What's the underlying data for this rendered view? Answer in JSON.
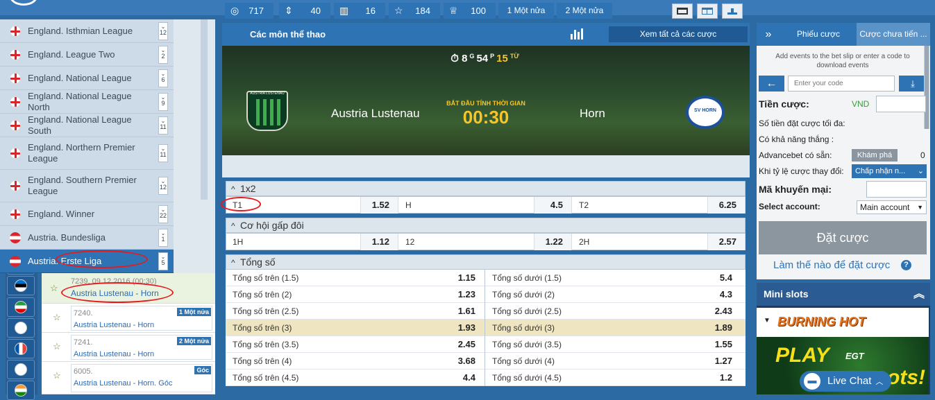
{
  "sidebar_leagues": [
    {
      "name": "England. Isthmian League",
      "count": "12"
    },
    {
      "name": "England. League Two",
      "count": "2"
    },
    {
      "name": "England. National League",
      "count": "6"
    },
    {
      "name": "England. National League North",
      "count": "9"
    },
    {
      "name": "England. National League South",
      "count": "11"
    },
    {
      "name": "England. Northern Premier League",
      "count": "11"
    },
    {
      "name": "England. Southern Premier League",
      "count": "12"
    },
    {
      "name": "England. Winner",
      "count": "22"
    },
    {
      "name": "Austria. Bundesliga",
      "count": "1"
    },
    {
      "name": "Austria. Erste Liga",
      "count": "5"
    }
  ],
  "sidebar_matches": [
    {
      "id": "7239. 09.12.2016 (00:30)",
      "name": "Austria Lustenau - Horn",
      "badge": ""
    },
    {
      "id": "7240.",
      "name": "Austria Lustenau - Horn",
      "badge": "1 Một nửa"
    },
    {
      "id": "7241.",
      "name": "Austria Lustenau - Horn",
      "badge": "2 Một nửa"
    },
    {
      "id": "6005.",
      "name": "Austria Lustenau - Horn. Góc",
      "badge": "Góc"
    }
  ],
  "header": {
    "title": "Các môn thể thao",
    "view_all": "Xem tất cả các cược"
  },
  "countdown": {
    "days": "8",
    "days_unit": "G",
    "hours": "54",
    "hours_unit": "P",
    "minutes": "15",
    "minutes_unit": "TỪ"
  },
  "event": {
    "home": "Austria Lustenau",
    "away": "Horn",
    "start_label": "BẮT ĐẦU TÍNH THỜI GIAN",
    "time": "00:30",
    "home_crest_text": "AUSTRIA LUSTENAU",
    "away_crest_text": "SV HORN"
  },
  "stats": [
    {
      "icon": "target-icon",
      "value": "717"
    },
    {
      "icon": "updown-icon",
      "value": "40"
    },
    {
      "icon": "bars-icon",
      "value": "16"
    },
    {
      "icon": "star-icon",
      "value": "184"
    },
    {
      "icon": "trophy-icon",
      "value": "100"
    }
  ],
  "half_tabs": [
    "1 Một nửa",
    "2 Một nửa"
  ],
  "markets": {
    "m1x2": {
      "title": "1x2",
      "cells": [
        [
          "T1",
          "1.52"
        ],
        [
          "H",
          "4.5"
        ],
        [
          "T2",
          "6.25"
        ]
      ]
    },
    "double": {
      "title": "Cơ hội gấp đôi",
      "cells": [
        [
          "1H",
          "1.12"
        ],
        [
          "12",
          "1.22"
        ],
        [
          "2H",
          "2.57"
        ]
      ]
    },
    "totals": {
      "title": "Tổng số",
      "rows": [
        {
          "over": "Tổng số trên (1.5)",
          "over_odd": "1.15",
          "under": "Tổng số dưới (1.5)",
          "under_odd": "5.4",
          "highlight": false
        },
        {
          "over": "Tổng số trên (2)",
          "over_odd": "1.23",
          "under": "Tổng số dưới (2)",
          "under_odd": "4.3",
          "highlight": false
        },
        {
          "over": "Tổng số trên (2.5)",
          "over_odd": "1.61",
          "under": "Tổng số dưới (2.5)",
          "under_odd": "2.43",
          "highlight": false
        },
        {
          "over": "Tổng số trên (3)",
          "over_odd": "1.93",
          "under": "Tổng số dưới (3)",
          "under_odd": "1.89",
          "highlight": true
        },
        {
          "over": "Tổng số trên (3.5)",
          "over_odd": "2.45",
          "under": "Tổng số dưới (3.5)",
          "under_odd": "1.55",
          "highlight": false
        },
        {
          "over": "Tổng số trên (4)",
          "over_odd": "3.68",
          "under": "Tổng số dưới (4)",
          "under_odd": "1.27",
          "highlight": false
        },
        {
          "over": "Tổng số trên (4.5)",
          "over_odd": "4.4",
          "under": "Tổng số dưới (4.5)",
          "under_odd": "1.2",
          "highlight": false
        }
      ]
    }
  },
  "betslip": {
    "tab1": "Phiếu cược",
    "tab2": "Cược chưa tiến ...",
    "hint": "Add events to the bet slip or enter a code to download events",
    "code_placeholder": "Enter your code",
    "stake_label": "Tiền cược:",
    "currency": "VND",
    "max_label": "Số tiền đặt cược tối đa:",
    "win_label": "Có khả năng thắng :",
    "advancebet_label": "Advancebet có sẵn:",
    "explore": "Khám phá",
    "advancebet_value": "0",
    "odds_change_label": "Khi tỷ lệ cược thay đổi:",
    "odds_change_value": "Chấp nhận n...",
    "promo_label": "Mã khuyến mại:",
    "account_label": "Select account:",
    "account_value": "Main account",
    "place_bet": "Đặt cược",
    "how_to": "Làm thế nào để đặt cược"
  },
  "mini": {
    "title": "Mini slots",
    "game": "BURNING HOT",
    "play": "PLAY",
    "brand": "EGT",
    "bg_text": "ots!"
  },
  "livechat": "Live Chat",
  "colors": {
    "primary": "#2e74b5",
    "accent_yellow": "#f7c52a",
    "highlight_row": "#efe5c0",
    "annotation_red": "#e8191c"
  }
}
